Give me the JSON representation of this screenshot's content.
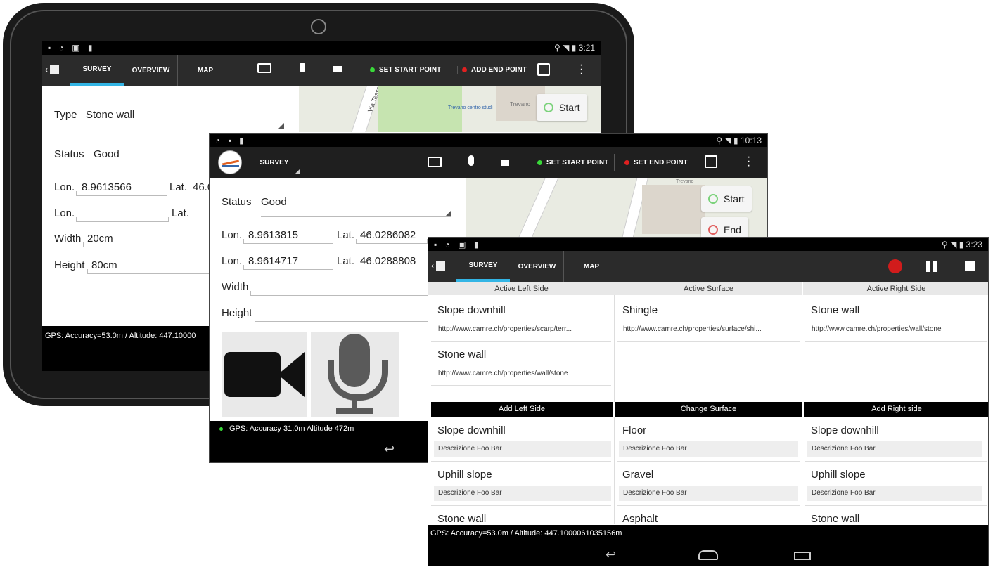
{
  "back_tablet": {
    "status_time": "3:21",
    "tabs": [
      "SURVEY",
      "OVERVIEW",
      "MAP"
    ],
    "actions": {
      "set_start": "SET START POINT",
      "add_end": "ADD END POINT"
    },
    "form": {
      "type_label": "Type",
      "type_value": "Stone wall",
      "status_label": "Status",
      "status_value": "Good",
      "lon_label": "Lon.",
      "lon1_value": "8.9613566",
      "lat_label": "Lat.",
      "lat1_value": "46.0",
      "lon2_value": "",
      "lat2_value": "",
      "width_label": "Width",
      "width_value": "20cm",
      "height_label": "Height",
      "height_value": "80cm"
    },
    "map": {
      "start_label": "Start",
      "street": "Via Tesse",
      "place1": "Trevano centro studi",
      "place2": "Trevano"
    },
    "gps": "GPS: Accuracy=53.0m  / Altitude: 447.10000"
  },
  "middle_phone": {
    "status_time": "10:13",
    "tab": "SURVEY",
    "actions": {
      "set_start": "SET START POINT",
      "set_end": "SET END POINT"
    },
    "form": {
      "status_label": "Status",
      "status_value": "Good",
      "lon_label": "Lon.",
      "lat_label": "Lat.",
      "lon1_value": "8.9613815",
      "lat1_value": "46.0286082",
      "lon2_value": "8.9614717",
      "lat2_value": "46.0288808",
      "width_label": "Width",
      "height_label": "Height"
    },
    "map": {
      "start_label": "Start",
      "end_label": "End",
      "place": "Trevano"
    },
    "gps": "GPS: Accuracy 31.0m Altitude 472m"
  },
  "front_tablet": {
    "status_time": "3:23",
    "tabs": [
      "SURVEY",
      "OVERVIEW",
      "MAP"
    ],
    "columns": [
      {
        "header": "Active Left Side",
        "active": [
          {
            "title": "Slope downhill",
            "url": "http://www.camre.ch/properties/scarp/terr..."
          },
          {
            "title": "Stone wall",
            "url": "http://www.camre.ch/properties/wall/stone"
          }
        ],
        "action": "Add Left Side",
        "options": [
          {
            "title": "Slope downhill",
            "desc": "Descrizione Foo Bar"
          },
          {
            "title": "Uphill slope",
            "desc": "Descrizione Foo Bar"
          },
          {
            "title": "Stone wall",
            "desc": ""
          }
        ]
      },
      {
        "header": "Active Surface",
        "active": [
          {
            "title": "Shingle",
            "url": "http://www.camre.ch/properties/surface/shi..."
          }
        ],
        "action": "Change Surface",
        "options": [
          {
            "title": "Floor",
            "desc": "Descrizione Foo Bar"
          },
          {
            "title": "Gravel",
            "desc": "Descrizione Foo Bar"
          },
          {
            "title": "Asphalt",
            "desc": ""
          }
        ]
      },
      {
        "header": "Active Right Side",
        "active": [
          {
            "title": "Stone wall",
            "url": "http://www.camre.ch/properties/wall/stone"
          }
        ],
        "action": "Add Right side",
        "options": [
          {
            "title": "Slope downhill",
            "desc": "Descrizione Foo Bar"
          },
          {
            "title": "Uphill slope",
            "desc": "Descrizione Foo Bar"
          },
          {
            "title": "Stone wall",
            "desc": ""
          }
        ]
      }
    ],
    "gps": "GPS: Accuracy=53.0m  / Altitude: 447.1000061035156m"
  }
}
